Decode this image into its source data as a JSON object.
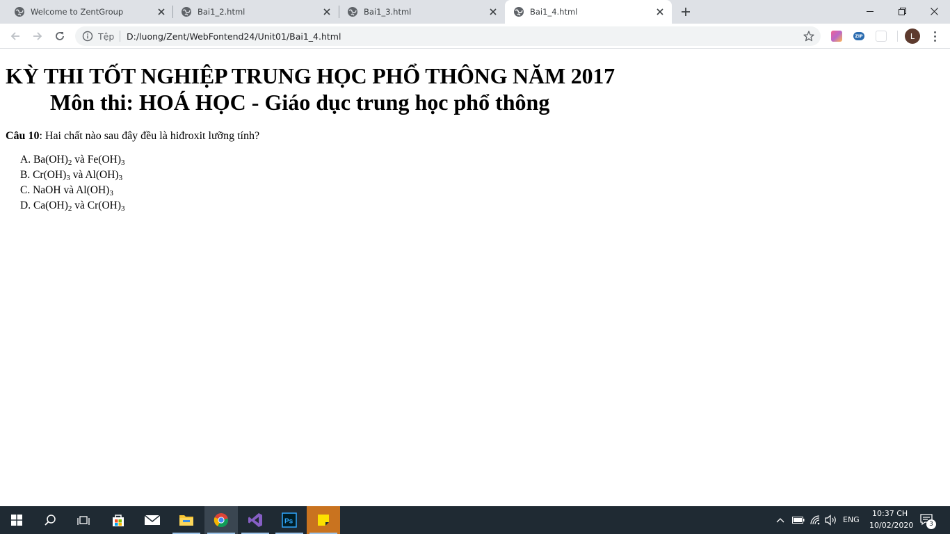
{
  "browser": {
    "tabs": [
      {
        "title": "Welcome to ZentGroup"
      },
      {
        "title": "Bai1_2.html"
      },
      {
        "title": "Bai1_3.html"
      },
      {
        "title": "Bai1_4.html",
        "active": true
      }
    ],
    "address_bar": {
      "scheme_label": "Tệp",
      "url": "D:/luong/Zent/WebFontend24/Unit01/Bai1_4.html"
    },
    "profile_initial": "L",
    "extensions": [
      "color-extension-icon",
      "zip-extension-icon",
      "pocket-extension-icon"
    ],
    "accent_color": "#1a73e8"
  },
  "page": {
    "title_line1": "KỲ THI TỐT NGHIỆP TRUNG HỌC PHỔ THÔNG NĂM 2017",
    "title_line2": "Môn thi: HOÁ HỌC - Giáo dục trung học phổ thông",
    "question_label": "Câu 10",
    "question_text": ": Hai chất nào sau đây đều là hiđroxit lưỡng tính?",
    "answers": [
      {
        "letter": "A.",
        "first": "Ba(OH)",
        "first_sub": "2",
        "joiner": " và ",
        "second": "Fe(OH)",
        "second_sub": "3"
      },
      {
        "letter": "B.",
        "first": "Cr(OH)",
        "first_sub": "3",
        "joiner": " và ",
        "second": "Al(OH)",
        "second_sub": "3"
      },
      {
        "letter": "C.",
        "first": "NaOH",
        "first_sub": "",
        "joiner": " và ",
        "second": "Al(OH)",
        "second_sub": "3"
      },
      {
        "letter": "D.",
        "first": "Ca(OH)",
        "first_sub": "2",
        "joiner": " và ",
        "second": "Cr(OH)",
        "second_sub": "3"
      }
    ]
  },
  "taskbar": {
    "apps": [
      "start-icon",
      "search-icon",
      "task-view-icon",
      "store-icon",
      "mail-icon",
      "file-explorer-icon",
      "chrome-icon",
      "visual-studio-icon",
      "photoshop-icon",
      "sticky-notes-icon"
    ],
    "language": "ENG",
    "time": "10:37 CH",
    "date": "10/02/2020",
    "notification_count": "3"
  }
}
